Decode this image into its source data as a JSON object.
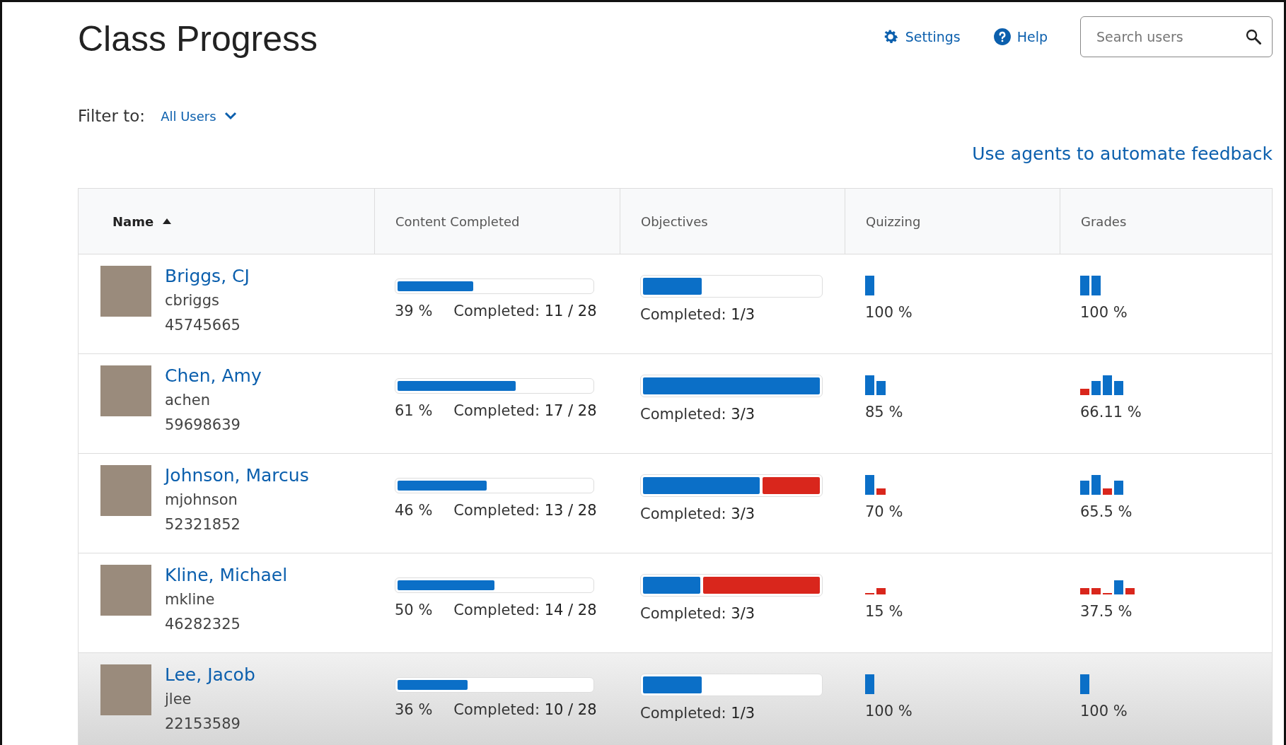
{
  "page": {
    "title": "Class Progress"
  },
  "toolbar": {
    "settings": "Settings",
    "help": "Help",
    "search": {
      "placeholder": "Search users"
    }
  },
  "filter": {
    "label": "Filter to:",
    "value": "All Users"
  },
  "automate_link": "Use agents to automate feedback",
  "table": {
    "columns": [
      {
        "label": "Name",
        "sorted": true
      },
      {
        "label": "Content Completed",
        "sorted": false
      },
      {
        "label": "Objectives",
        "sorted": false
      },
      {
        "label": "Quizzing",
        "sorted": false
      },
      {
        "label": "Grades",
        "sorted": false
      }
    ],
    "rows": [
      {
        "name": "Briggs, CJ",
        "username": "cbriggs",
        "id": "45745665",
        "content": {
          "level": 0.39,
          "percent": "39 %",
          "completed_label": "Completed:",
          "completed": "11 / 28"
        },
        "objectives": {
          "segments": [
            {
              "level": 0.33,
              "color": "#0b6fc7"
            }
          ],
          "completed_label": "Completed:",
          "completed": "1/3"
        },
        "quizzing": {
          "bars": [
            {
              "kind": "full",
              "color": "#0b6fc7"
            }
          ],
          "score": "100 %"
        },
        "grades": {
          "bars": [
            {
              "kind": "full",
              "color": "#0b6fc7"
            },
            {
              "kind": "full",
              "color": "#0b6fc7"
            }
          ],
          "score": "100 %"
        }
      },
      {
        "name": "Chen, Amy",
        "username": "achen",
        "id": "59698639",
        "content": {
          "level": 0.61,
          "percent": "61 %",
          "completed_label": "Completed:",
          "completed": "17 / 28"
        },
        "objectives": {
          "segments": [
            {
              "level": 1,
              "color": "#0b6fc7"
            }
          ],
          "completed_label": "Completed:",
          "completed": "3/3"
        },
        "quizzing": {
          "bars": [
            {
              "kind": "full",
              "color": "#0b6fc7"
            },
            {
              "kind": "high",
              "color": "#0b6fc7"
            }
          ],
          "score": "85 %"
        },
        "grades": {
          "bars": [
            {
              "kind": "low",
              "color": "#d9261c"
            },
            {
              "kind": "high",
              "color": "#0b6fc7"
            },
            {
              "kind": "full",
              "color": "#0b6fc7"
            },
            {
              "kind": "high",
              "color": "#0b6fc7"
            }
          ],
          "score": "66.11 %"
        }
      },
      {
        "name": "Johnson, Marcus",
        "username": "mjohnson",
        "id": "52321852",
        "content": {
          "level": 0.46,
          "percent": "46 %",
          "completed_label": "Completed:",
          "completed": "13 / 28"
        },
        "objectives": {
          "segments": [
            {
              "level": 0.67,
              "color": "#0b6fc7"
            },
            {
              "level": 0.33,
              "color": "#d9261c"
            }
          ],
          "completed_label": "Completed:",
          "completed": "3/3"
        },
        "quizzing": {
          "bars": [
            {
              "kind": "full",
              "color": "#0b6fc7"
            },
            {
              "kind": "low",
              "color": "#d9261c"
            }
          ],
          "score": "70 %"
        },
        "grades": {
          "bars": [
            {
              "kind": "high",
              "color": "#0b6fc7"
            },
            {
              "kind": "full",
              "color": "#0b6fc7"
            },
            {
              "kind": "low",
              "color": "#d9261c"
            },
            {
              "kind": "high",
              "color": "#0b6fc7"
            }
          ],
          "score": "65.5 %"
        }
      },
      {
        "name": "Kline, Michael",
        "username": "mkline",
        "id": "46282325",
        "content": {
          "level": 0.5,
          "percent": "50 %",
          "completed_label": "Completed:",
          "completed": "14 / 28"
        },
        "objectives": {
          "segments": [
            {
              "level": 0.33,
              "color": "#0b6fc7"
            },
            {
              "level": 0.67,
              "color": "#d9261c"
            }
          ],
          "completed_label": "Completed:",
          "completed": "3/3"
        },
        "quizzing": {
          "bars": [
            {
              "kind": "empty",
              "color": "#d9261c"
            },
            {
              "kind": "low",
              "color": "#d9261c"
            }
          ],
          "score": "15 %"
        },
        "grades": {
          "bars": [
            {
              "kind": "low",
              "color": "#d9261c"
            },
            {
              "kind": "low",
              "color": "#d9261c"
            },
            {
              "kind": "empty",
              "color": "#d9261c"
            },
            {
              "kind": "high",
              "color": "#0b6fc7"
            },
            {
              "kind": "low",
              "color": "#d9261c"
            }
          ],
          "score": "37.5 %"
        }
      },
      {
        "name": "Lee, Jacob",
        "username": "jlee",
        "id": "22153589",
        "content": {
          "level": 0.36,
          "percent": "36 %",
          "completed_label": "Completed:",
          "completed": "10 / 28"
        },
        "objectives": {
          "segments": [
            {
              "level": 0.33,
              "color": "#0b6fc7"
            }
          ],
          "completed_label": "Completed:",
          "completed": "1/3"
        },
        "quizzing": {
          "bars": [
            {
              "kind": "full",
              "color": "#0b6fc7"
            }
          ],
          "score": "100 %"
        },
        "grades": {
          "bars": [
            {
              "kind": "full",
              "color": "#0b6fc7"
            }
          ],
          "score": "100 %"
        }
      }
    ]
  }
}
